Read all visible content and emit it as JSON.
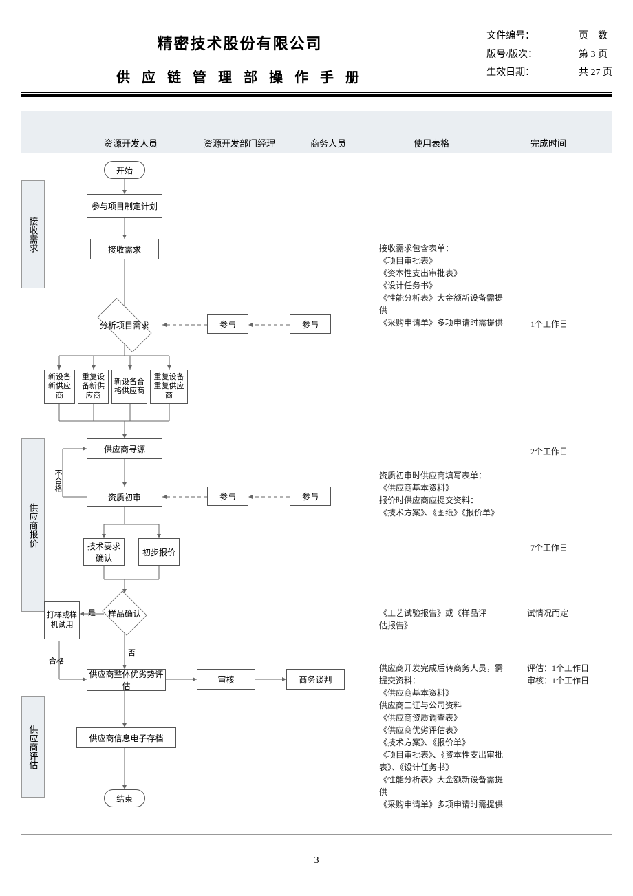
{
  "header": {
    "company": "精密技术股份有限公司",
    "manual": "供 应 链 管 理 部 操 作 手 册",
    "labels": {
      "docno": "文件编号：",
      "version": "版号/版次：",
      "effective": "生效日期："
    },
    "page_title": "页　数",
    "page_current": "第 3 页",
    "page_total": "共 27 页"
  },
  "columns": {
    "c1": "资源开发人员",
    "c2": "资源开发部门经理",
    "c3": "商务人员",
    "c4": "使用表格",
    "c5": "完成时间"
  },
  "lanes": {
    "l1": "接收需求",
    "l2": "供应商报价",
    "l3": "供应商评估"
  },
  "nodes": {
    "start": "开始",
    "plan": "参与项目制定计划",
    "recv": "接收需求",
    "analyze": "分析项目需求",
    "part1": "参与",
    "part2": "参与",
    "cat1": "新设备新供应商",
    "cat2": "重复设备新供应商",
    "cat3": "新设备合格供应商",
    "cat4": "重复设备重复供应商",
    "source": "供应商寻源",
    "prelim": "资质初审",
    "part3": "参与",
    "part4": "参与",
    "tech": "技术要求确认",
    "quote": "初步报价",
    "sample": "样品确认",
    "proto": "打样或样机试用",
    "eval": "供应商整体优劣势评估",
    "review": "审核",
    "negotiate": "商务谈判",
    "archive": "供应商信息电子存档",
    "end": "结束"
  },
  "edges": {
    "no": "不合格",
    "yes": "是",
    "else": "否",
    "ok": "合格"
  },
  "annot": {
    "a1": "接收需求包含表单：\n《项目审批表》\n《资本性支出审批表》\n《设计任务书》\n《性能分析表》大金额新设备需提供\n《采购申请单》多项申请时需提供",
    "a2": "资质初审时供应商填写表单：\n《供应商基本资料》\n报价时供应商应提交资料：\n《技术方案》、《图纸》《报价单》",
    "a3": "《工艺试验报告》或《样品评估报告》",
    "a4": "供应商开发完成后转商务人员，需提交资料：\n《供应商基本资料》\n供应商三证与公司资料\n《供应商资质调查表》\n《供应商优劣评估表》\n《技术方案》、《报价单》\n《项目审批表》、《资本性支出审批表》、《设计任务书》\n《性能分析表》大金额新设备需提供\n《采购申请单》多项申请时需提供"
  },
  "times": {
    "t1": "1个工作日",
    "t2": "2个工作日",
    "t3": "7个工作日",
    "t4": "试情况而定",
    "t5": "评估：1个工作日\n审核：1个工作日"
  },
  "pagenum": "3"
}
